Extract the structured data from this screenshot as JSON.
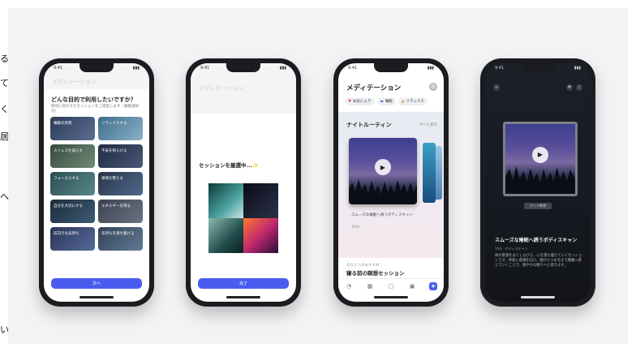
{
  "edge_text": [
    "る",
    "て",
    "く",
    "居",
    "へ",
    "い"
  ],
  "phone1": {
    "time": "9:41",
    "header_ghost": "メディテーション",
    "question": "どんな目的で利用したいですか？",
    "subtitle": "目的に合わせたセッションをご提案します（複数選択可）",
    "options": [
      "睡眠の改善",
      "リラックスする",
      "ストレスを減らす",
      "不安を和らげる",
      "フォーカスする",
      "感情を整える",
      "自分を大切にする",
      "エネルギーを得る",
      "前向きな気持ち",
      "気持ちを落ち着ける"
    ],
    "button": "次へ"
  },
  "phone2": {
    "time": "9:41",
    "header_ghost": "メディテーション",
    "loading": "セッションを厳選中...",
    "loading_emoji": "✨",
    "button": "完了"
  },
  "phone3": {
    "time": "9:41",
    "title": "メディテーション",
    "chips": [
      {
        "icon": "heart-icon",
        "label": "お気に入り",
        "color": "#e23b5b"
      },
      {
        "icon": "bed-icon",
        "label": "睡眠",
        "color": "#3a5cd8"
      },
      {
        "icon": "person-icon",
        "label": "リラックス",
        "color": "#e28a3b"
      }
    ],
    "section_title": "ナイトルーティン",
    "section_more": "すべて表示",
    "card_title": "スムーズな睡眠へ誘うボディスキャン",
    "card_duration": "10分",
    "rec_label": "あなたへのおすすめ",
    "rec_title": "寝る前の瞑想セッション",
    "tabs": [
      "today-icon",
      "library-icon",
      "chat-icon",
      "calendar-icon",
      "meditation-icon"
    ]
  },
  "phone4": {
    "time": "9:41",
    "badge": "ガイド瞑想",
    "title": "スムーズな睡眠へ誘うボディスキャン",
    "meta": "10分 · ボディスキャン",
    "description": "体の緊張をほぐしながら、心を落ち着けていくセッションです。呼吸に意識を向け、頭からつま先まで順番に感じていくことで、穏やかな眠りへと導きます。"
  },
  "colors": {
    "accent": "#4a5cf0",
    "dark": "#1b1c20"
  }
}
